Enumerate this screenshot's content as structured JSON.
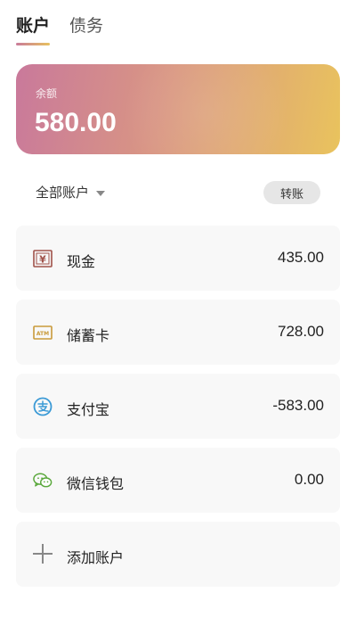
{
  "tabs": [
    {
      "label": "账户",
      "active": true
    },
    {
      "label": "债务",
      "active": false
    }
  ],
  "balance": {
    "label": "余额",
    "value": "580.00"
  },
  "filter": {
    "label": "全部账户",
    "transfer_label": "转账"
  },
  "accounts": [
    {
      "name": "现金",
      "amount": "435.00",
      "icon": "cash-yuan-icon"
    },
    {
      "name": "储蓄卡",
      "amount": "728.00",
      "icon": "atm-card-icon"
    },
    {
      "name": "支付宝",
      "amount": "-583.00",
      "icon": "alipay-icon"
    },
    {
      "name": "微信钱包",
      "amount": "0.00",
      "icon": "wechat-icon"
    }
  ],
  "add_account": {
    "label": "添加账户"
  },
  "colors": {
    "card_gradient_start": "#c9799b",
    "card_gradient_end": "#e9c35d",
    "cash_icon": "#a0524a",
    "atm_icon": "#c99a3a",
    "alipay_icon": "#3b9ad6",
    "wechat_icon": "#5aa83c"
  }
}
